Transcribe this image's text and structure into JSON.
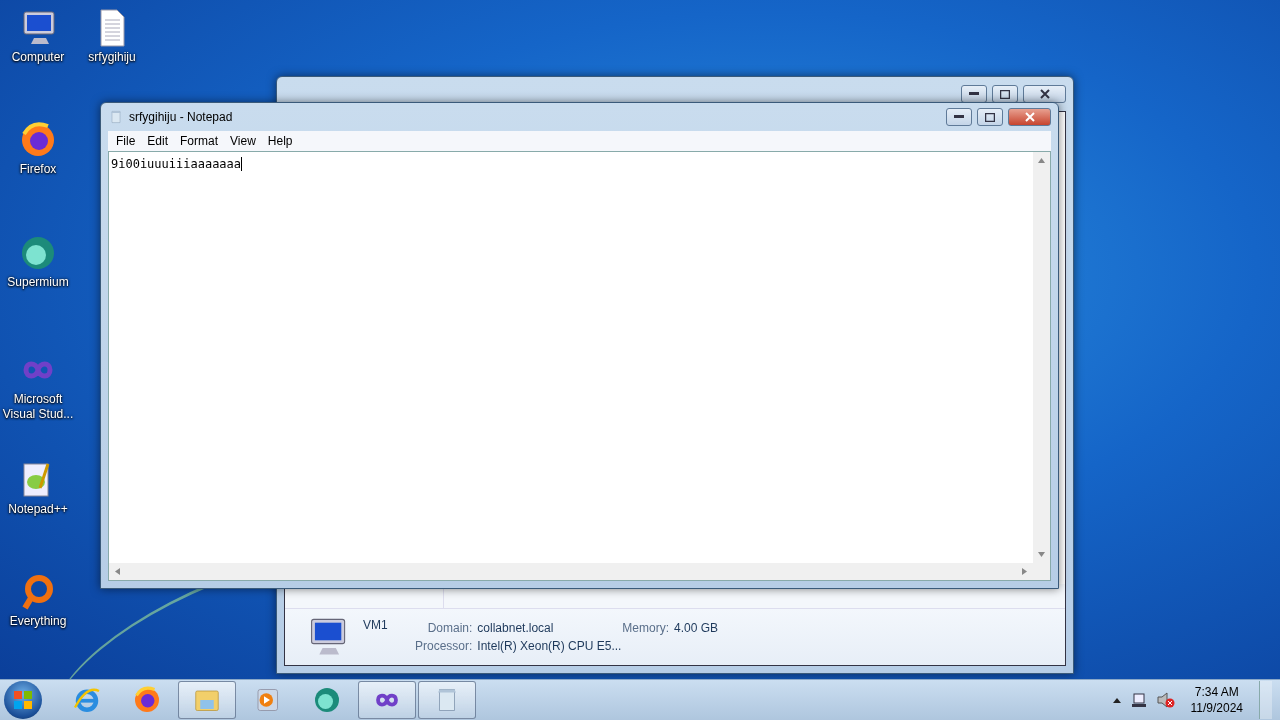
{
  "desktop_icons": [
    {
      "label": "Computer",
      "kind": "computer"
    },
    {
      "label": "srfygihiju",
      "kind": "document"
    },
    {
      "label": "Firefox",
      "kind": "firefox"
    },
    {
      "label": "Supermium",
      "kind": "supermium"
    },
    {
      "label": "Microsoft Visual Stud...",
      "kind": "vs"
    },
    {
      "label": "Notepad++",
      "kind": "notepadpp"
    },
    {
      "label": "Everything",
      "kind": "everything"
    }
  ],
  "back_window": {
    "details": {
      "name": "VM1",
      "fields": [
        {
          "label": "Domain:",
          "value": "collabnet.local"
        },
        {
          "label": "Memory:",
          "value": "4.00 GB"
        },
        {
          "label": "Processor:",
          "value": "Intel(R) Xeon(R) CPU E5..."
        }
      ]
    }
  },
  "notepad": {
    "title": "srfygihiju - Notepad",
    "menu": [
      "File",
      "Edit",
      "Format",
      "View",
      "Help"
    ],
    "text": "9i00iuuuiiiaaaaaaa"
  },
  "taskbar": {
    "items": [
      {
        "kind": "ie",
        "running": false
      },
      {
        "kind": "firefox",
        "running": false
      },
      {
        "kind": "explorer",
        "running": true
      },
      {
        "kind": "media",
        "running": false
      },
      {
        "kind": "supermium",
        "running": false
      },
      {
        "kind": "vs",
        "running": true
      },
      {
        "kind": "notepad",
        "running": true
      }
    ],
    "clock": {
      "time": "7:34 AM",
      "date": "11/9/2024"
    }
  }
}
